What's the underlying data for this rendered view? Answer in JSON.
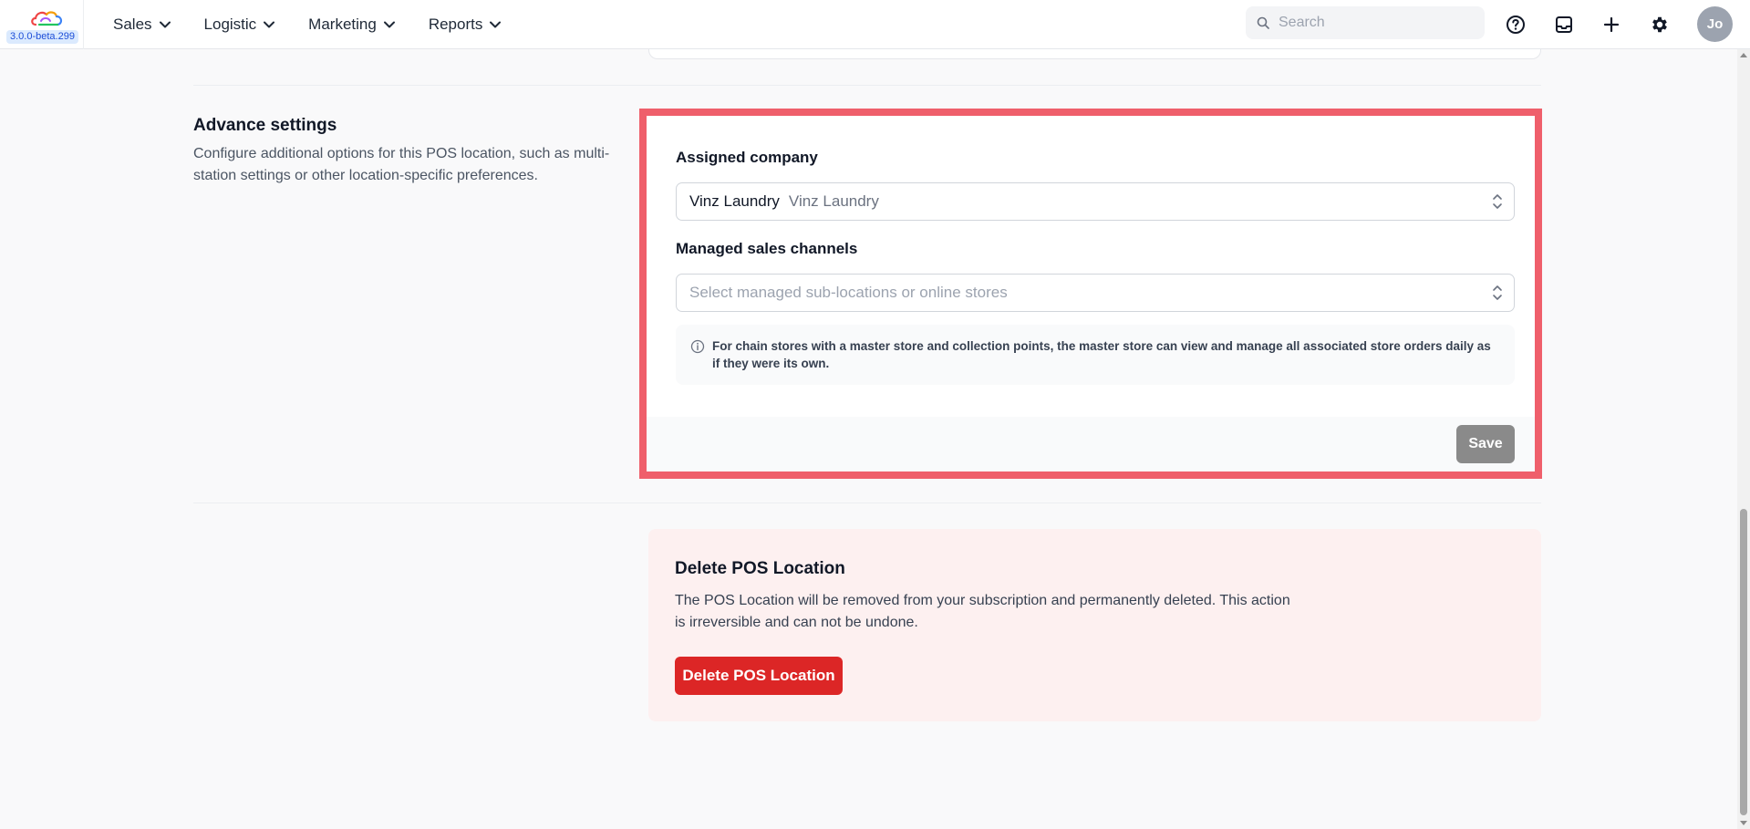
{
  "app": {
    "version": "3.0.0-beta.299",
    "brand_colors": [
      "#ef4444",
      "#f59e0b",
      "#3b82f6",
      "#22c55e"
    ]
  },
  "nav": {
    "items": [
      {
        "label": "Sales"
      },
      {
        "label": "Logistic"
      },
      {
        "label": "Marketing"
      },
      {
        "label": "Reports"
      }
    ]
  },
  "search": {
    "placeholder": "Search"
  },
  "toolbar_icons": [
    "help-icon",
    "inbox-icon",
    "plus-icon",
    "gear-icon"
  ],
  "user": {
    "initials": "Jo"
  },
  "advance_settings": {
    "title": "Advance settings",
    "description": "Configure additional options for this POS location, such as multi-station settings or other location-specific preferences.",
    "assigned_company": {
      "label": "Assigned company",
      "value": "Vinz Laundry",
      "secondary": "Vinz Laundry"
    },
    "managed_sales_channels": {
      "label": "Managed sales channels",
      "placeholder": "Select managed sub-locations or online stores"
    },
    "info": "For chain stores with a master store and collection points, the master store can view and manage all associated store orders daily as if they were its own.",
    "save_label": "Save"
  },
  "delete_section": {
    "title": "Delete POS Location",
    "description": "The POS Location will be removed from your subscription and permanently deleted. This action is irreversible and can not be undone.",
    "button_label": "Delete POS Location"
  },
  "colors": {
    "highlight": "#ef5f6b",
    "danger": "#dc2626",
    "save_disabled": "#8a8a8a"
  }
}
